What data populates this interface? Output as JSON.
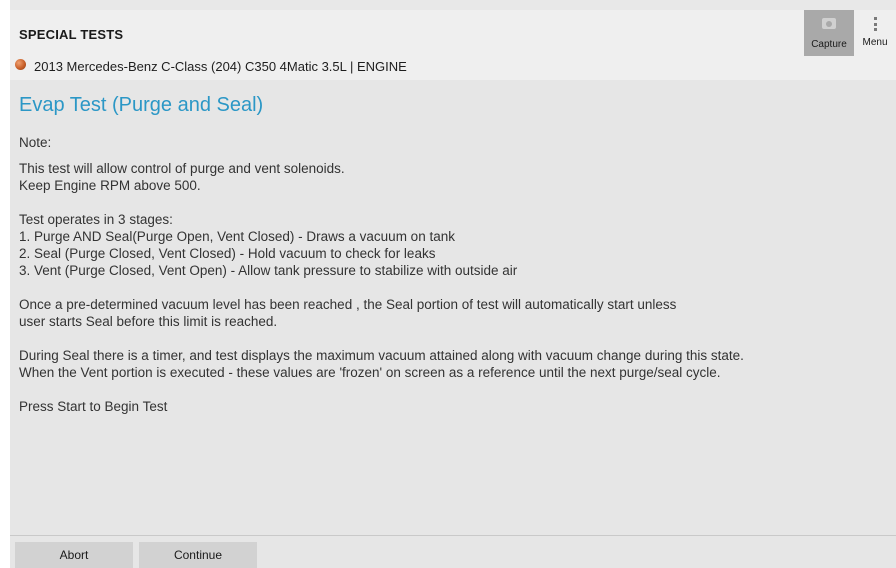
{
  "header": {
    "title": "SPECIAL TESTS",
    "vehicle": "2013 Mercedes-Benz C-Class (204) C350 4Matic 3.5L | ENGINE",
    "capture_label": "Capture",
    "menu_label": "Menu"
  },
  "main": {
    "title": "Evap Test (Purge and Seal)",
    "note_label": "Note:",
    "paragraphs": [
      [
        "This test will allow control of purge and vent solenoids.",
        "Keep Engine RPM above 500."
      ],
      [
        "Test operates in 3 stages:",
        "1. Purge AND Seal(Purge Open, Vent Closed) - Draws a vacuum on tank",
        "2. Seal (Purge Closed, Vent Closed) - Hold vacuum to check for leaks",
        "3. Vent (Purge Closed, Vent Open) - Allow tank pressure to stabilize with outside air"
      ],
      [
        "Once a pre-determined vacuum level has been reached , the Seal portion of test will automatically start unless",
        "user starts Seal before this limit is reached."
      ],
      [
        "During Seal there is a timer, and test displays the maximum vacuum attained along with vacuum change during this state.",
        "When the Vent portion is executed - these values are 'frozen' on screen as a reference until the next purge/seal cycle."
      ],
      [
        "Press Start to Begin Test"
      ]
    ]
  },
  "footer": {
    "abort_label": "Abort",
    "continue_label": "Continue"
  },
  "colors": {
    "title_accent": "#2b97c6",
    "status_dot": "#c8602a"
  }
}
